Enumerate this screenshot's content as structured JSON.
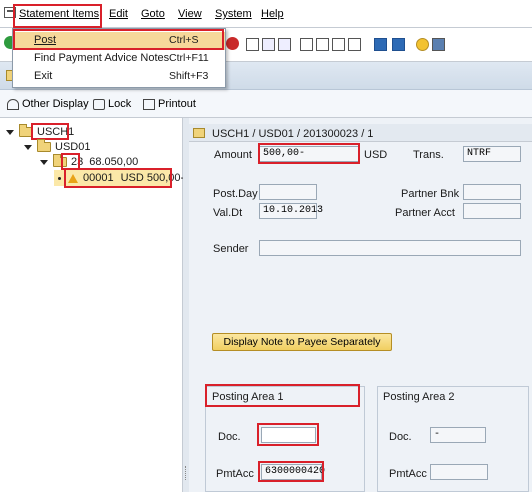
{
  "menu": {
    "items": [
      "Statement Items",
      "Edit",
      "Goto",
      "View",
      "System",
      "Help"
    ],
    "dropdown": [
      {
        "label": "Post",
        "shortcut": "Ctrl+S",
        "selected": true
      },
      {
        "label": "Find Payment Advice Notes",
        "shortcut": "Ctrl+F11",
        "selected": false
      },
      {
        "label": "Exit",
        "shortcut": "Shift+F3",
        "selected": false
      }
    ]
  },
  "appbar": {
    "other_display": "Other Display",
    "lock": "Lock",
    "printout": "Printout"
  },
  "tree": {
    "root": "USCH1",
    "child": "USD01",
    "statement_no": "23",
    "statement_amount": "68.050,00",
    "item_no": "00001",
    "item_amount": "USD 500,00-"
  },
  "detail": {
    "header": "USCH1 / USD01 / 201300023 / 1",
    "amount_label": "Amount",
    "amount_value": "500,00-",
    "currency": "USD",
    "trans_label": "Trans.",
    "trans_value": "NTRF",
    "post_day_label": "Post.Day",
    "post_day_value": "",
    "partner_bank_label": "Partner Bnk",
    "partner_bank_value": "",
    "val_dt_label": "Val.Dt",
    "val_dt_value": "10.10.2013",
    "partner_acct_label": "Partner Acct",
    "partner_acct_value": "",
    "sender_label": "Sender",
    "sender_value": "",
    "note_button": "Display Note to Payee Separately"
  },
  "posting_area_1": {
    "title": "Posting Area 1",
    "doc_label": "Doc.",
    "doc_value": "",
    "pmtacc_label": "PmtAcc",
    "pmtacc_value": "6300000420"
  },
  "posting_area_2": {
    "title": "Posting Area 2",
    "doc_label": "Doc.",
    "doc_value": "-",
    "pmtacc_label": "PmtAcc",
    "pmtacc_value": ""
  },
  "colors": {
    "highlight_red": "#d9202a",
    "selected_menu": "#f6d89a",
    "button_yellow": "#f1cf61"
  }
}
